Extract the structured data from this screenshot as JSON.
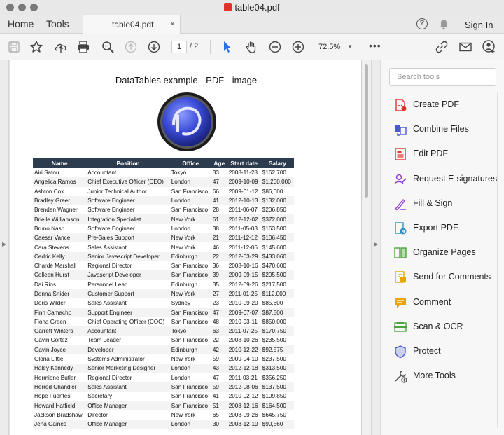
{
  "window": {
    "title": "table04.pdf"
  },
  "menubar": {
    "home": "Home",
    "tools": "Tools",
    "tab_label": "table04.pdf",
    "tab_close": "×",
    "help": "?",
    "signin": "Sign In"
  },
  "toolbar": {
    "page_current": "1",
    "page_total": "/ 2",
    "zoom": "72.5%",
    "more": "•••"
  },
  "document": {
    "heading": "DataTables example - PDF - image",
    "columns": [
      "Name",
      "Position",
      "Office",
      "Age",
      "Start date",
      "Salary"
    ],
    "rows": [
      [
        "Airi Satou",
        "Accountant",
        "Tokyo",
        "33",
        "2008-11-28",
        "$162,700"
      ],
      [
        "Angelica Ramos",
        "Chief Executive Officer (CEO)",
        "London",
        "47",
        "2009-10-09",
        "$1,200,000"
      ],
      [
        "Ashton Cox",
        "Junior Technical Author",
        "San Francisco",
        "66",
        "2009-01-12",
        "$86,000"
      ],
      [
        "Bradley Greer",
        "Software Engineer",
        "London",
        "41",
        "2012-10-13",
        "$132,000"
      ],
      [
        "Brenden Wagner",
        "Software Engineer",
        "San Francisco",
        "28",
        "2011-06-07",
        "$206,850"
      ],
      [
        "Brielle Williamson",
        "Integration Specialist",
        "New York",
        "61",
        "2012-12-02",
        "$372,000"
      ],
      [
        "Bruno Nash",
        "Software Engineer",
        "London",
        "38",
        "2011-05-03",
        "$163,500"
      ],
      [
        "Caesar Vance",
        "Pre-Sales Support",
        "New York",
        "21",
        "2011-12-12",
        "$106,450"
      ],
      [
        "Cara Stevens",
        "Sales Assistant",
        "New York",
        "46",
        "2011-12-06",
        "$145,600"
      ],
      [
        "Cedric Kelly",
        "Senior Javascript Developer",
        "Edinburgh",
        "22",
        "2012-03-29",
        "$433,060"
      ],
      [
        "Charde Marshall",
        "Regional Director",
        "San Francisco",
        "36",
        "2008-10-16",
        "$470,600"
      ],
      [
        "Colleen Hurst",
        "Javascript Developer",
        "San Francisco",
        "39",
        "2009-09-15",
        "$205,500"
      ],
      [
        "Dai Rios",
        "Personnel Lead",
        "Edinburgh",
        "35",
        "2012-09-26",
        "$217,500"
      ],
      [
        "Donna Snider",
        "Customer Support",
        "New York",
        "27",
        "2011-01-25",
        "$112,000"
      ],
      [
        "Doris Wilder",
        "Sales Assistant",
        "Sydney",
        "23",
        "2010-09-20",
        "$85,600"
      ],
      [
        "Finn Camacho",
        "Support Engineer",
        "San Francisco",
        "47",
        "2009-07-07",
        "$87,500"
      ],
      [
        "Fiona Green",
        "Chief Operating Officer (COO)",
        "San Francisco",
        "48",
        "2010-03-11",
        "$850,000"
      ],
      [
        "Garrett Winters",
        "Accountant",
        "Tokyo",
        "63",
        "2011-07-25",
        "$170,750"
      ],
      [
        "Gavin Cortez",
        "Team Leader",
        "San Francisco",
        "22",
        "2008-10-26",
        "$235,500"
      ],
      [
        "Gavin Joyce",
        "Developer",
        "Edinburgh",
        "42",
        "2010-12-22",
        "$92,575"
      ],
      [
        "Gloria Little",
        "Systems Administrator",
        "New York",
        "59",
        "2009-04-10",
        "$237,500"
      ],
      [
        "Haley Kennedy",
        "Senior Marketing Designer",
        "London",
        "43",
        "2012-12-18",
        "$313,500"
      ],
      [
        "Hermione Butler",
        "Regional Director",
        "London",
        "47",
        "2011-03-21",
        "$356,250"
      ],
      [
        "Herrod Chandler",
        "Sales Assistant",
        "San Francisco",
        "59",
        "2012-08-06",
        "$137,500"
      ],
      [
        "Hope Fuentes",
        "Secretary",
        "San Francisco",
        "41",
        "2010-02-12",
        "$109,850"
      ],
      [
        "Howard Hatfield",
        "Office Manager",
        "San Francisco",
        "51",
        "2008-12-16",
        "$164,500"
      ],
      [
        "Jackson Bradshaw",
        "Director",
        "New York",
        "65",
        "2008-09-26",
        "$645,750"
      ],
      [
        "Jena Gaines",
        "Office Manager",
        "London",
        "30",
        "2008-12-19",
        "$90,560"
      ]
    ]
  },
  "tools_panel": {
    "search_placeholder": "Search tools",
    "tools": [
      {
        "label": "Create PDF",
        "icon": "create-pdf-icon",
        "color": "#e0332c"
      },
      {
        "label": "Combine Files",
        "icon": "combine-files-icon",
        "color": "#4a57d0"
      },
      {
        "label": "Edit PDF",
        "icon": "edit-pdf-icon",
        "color": "#e0332c"
      },
      {
        "label": "Request E-signatures",
        "icon": "request-esign-icon",
        "color": "#8f3bd6"
      },
      {
        "label": "Fill & Sign",
        "icon": "fill-sign-icon",
        "color": "#8f3bd6"
      },
      {
        "label": "Export PDF",
        "icon": "export-pdf-icon",
        "color": "#2d8fc4"
      },
      {
        "label": "Organize Pages",
        "icon": "organize-pages-icon",
        "color": "#4aa53a"
      },
      {
        "label": "Send for Comments",
        "icon": "send-comments-icon",
        "color": "#e6a800"
      },
      {
        "label": "Comment",
        "icon": "comment-icon",
        "color": "#e6a800"
      },
      {
        "label": "Scan & OCR",
        "icon": "scan-ocr-icon",
        "color": "#4aa53a"
      },
      {
        "label": "Protect",
        "icon": "protect-icon",
        "color": "#4a57d0"
      },
      {
        "label": "More Tools",
        "icon": "more-tools-icon",
        "color": "#555555"
      }
    ]
  }
}
